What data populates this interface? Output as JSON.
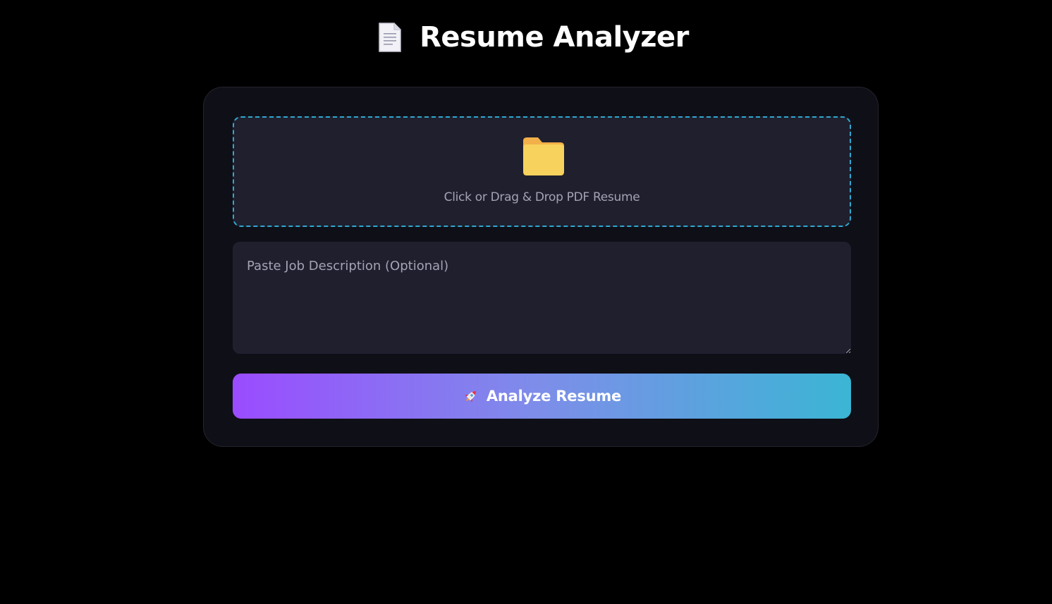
{
  "header": {
    "icon": "document-icon",
    "title": "Resume Analyzer"
  },
  "upload": {
    "icon": "folder-icon",
    "label": "Click or Drag & Drop PDF Resume"
  },
  "job_description": {
    "value": "",
    "placeholder": "Paste Job Description (Optional)"
  },
  "analyze_button": {
    "icon": "rocket-icon",
    "label": "Analyze Resume"
  },
  "colors": {
    "page_background": "#000000",
    "card_background": "#0f0f17",
    "input_background": "#1f1f2e",
    "dropzone_border": "#2fa9cf",
    "button_gradient_start": "#9a4cff",
    "button_gradient_end": "#3bb5d4",
    "title_text": "#ffffff",
    "muted_text": "#a3a3b4"
  }
}
